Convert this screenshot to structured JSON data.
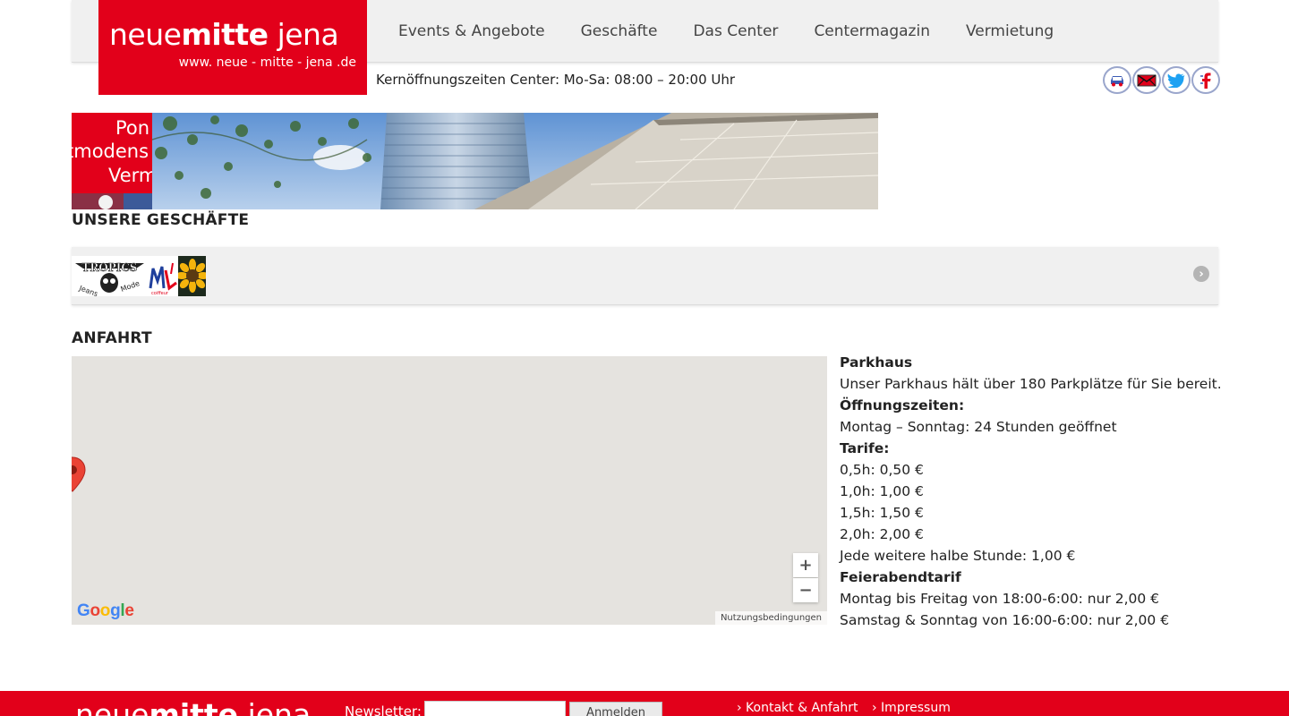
{
  "header": {
    "logo_main_regular": "neue",
    "logo_main_bold": "mitte",
    "logo_main_rest": " jena",
    "logo_url": "www. neue - mitte - jena .de",
    "hours": "Kernöffnungszeiten Center: Mo-Sa: 08:00 – 20:00 Uhr"
  },
  "nav": {
    "items": [
      {
        "label": "Events & Angebote"
      },
      {
        "label": "Geschäfte"
      },
      {
        "label": "Das Center"
      },
      {
        "label": "Centermagazin"
      },
      {
        "label": "Vermietung"
      }
    ]
  },
  "social": {
    "icons": [
      "car-icon",
      "mail-icon",
      "twitter-icon",
      "facebook-icon"
    ],
    "accent": "#9aa6cc"
  },
  "banner": {
    "line1": "Pon",
    "line2": "tmodens",
    "line3": "Verm"
  },
  "shops": {
    "title": "UNSERE GESCHÄFTE",
    "tropics_text": "TROPICS",
    "tropics_sub1": "Jeans",
    "tropics_sub2": "Mode",
    "ml_sub": "coiffeur",
    "next_label": "›"
  },
  "anfahrt": {
    "title": "ANFAHRT",
    "map": {
      "google_letters": [
        "G",
        "o",
        "o",
        "g",
        "l",
        "e"
      ],
      "zoom_in": "+",
      "zoom_out": "−",
      "terms": "Nutzungsbedingungen"
    },
    "parking": {
      "title": "Parkhaus",
      "intro": "Unser Parkhaus hält über 180 Parkplätze für Sie bereit.",
      "hours_title": "Öffnungszeiten:",
      "hours": "Montag – Sonntag: 24 Stunden geöffnet",
      "tariffs_title": "Tarife:",
      "tariffs": [
        "0,5h: 0,50 €",
        "1,0h: 1,00 €",
        "1,5h: 1,50 €",
        "2,0h: 2,00 €"
      ],
      "extra": "Jede weitere halbe Stunde: 1,00 €",
      "evening_title": "Feierabendtarif",
      "evening": [
        "Montag bis Freitag von 18:00-6:00: nur 2,00 €",
        "Samstag & Sonntag von 16:00-6:00: nur 2,00 €"
      ]
    }
  },
  "footer": {
    "logo_regular": "neue",
    "logo_bold": "mitte",
    "logo_rest": " jena",
    "newsletter_label": "Newsletter:",
    "newsletter_placeholder": "",
    "button": "Anmelden",
    "links": [
      "› Kontakt & Anfahrt",
      "› Impressum"
    ]
  },
  "colors": {
    "brand_red": "#e2001a",
    "map_bg": "#e5e3df",
    "bar_bg": "#f0f0f0"
  }
}
